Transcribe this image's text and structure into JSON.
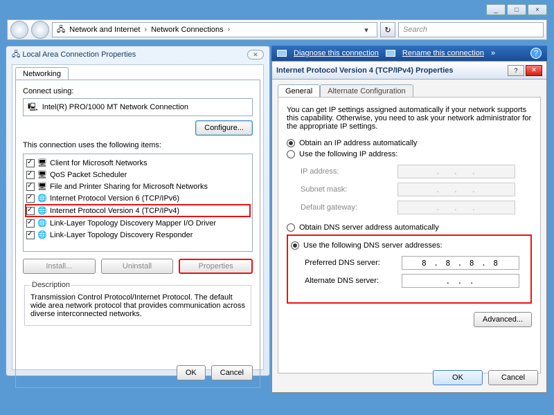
{
  "chrome": {
    "min": "_",
    "max": "□",
    "close": "×"
  },
  "nav": {
    "crumb1": "Network and Internet",
    "crumb2": "Network Connections",
    "search_placeholder": "Search"
  },
  "bluebar": {
    "diagnose": "Diagnose this connection",
    "rename": "Rename this connection",
    "more": "»"
  },
  "lan": {
    "title": "Local Area Connection Properties",
    "tab": "Networking",
    "connect_using": "Connect using:",
    "adapter": "Intel(R) PRO/1000 MT Network Connection",
    "configure": "Configure...",
    "uses_items": "This connection uses the following items:",
    "items": [
      "Client for Microsoft Networks",
      "QoS Packet Scheduler",
      "File and Printer Sharing for Microsoft Networks",
      "Internet Protocol Version 6 (TCP/IPv6)",
      "Internet Protocol Version 4 (TCP/IPv4)",
      "Link-Layer Topology Discovery Mapper I/O Driver",
      "Link-Layer Topology Discovery Responder"
    ],
    "install": "Install...",
    "uninstall": "Uninstall",
    "properties": "Properties",
    "desc_legend": "Description",
    "desc_text": "Transmission Control Protocol/Internet Protocol. The default wide area network protocol that provides communication across diverse interconnected networks.",
    "ok": "OK",
    "cancel": "Cancel"
  },
  "ipv4": {
    "title": "Internet Protocol Version 4 (TCP/IPv4) Properties",
    "tab_general": "General",
    "tab_alt": "Alternate Configuration",
    "intro": "You can get IP settings assigned automatically if your network supports this capability. Otherwise, you need to ask your network administrator for the appropriate IP settings.",
    "r_auto_ip": "Obtain an IP address automatically",
    "r_manual_ip": "Use the following IP address:",
    "lbl_ip": "IP address:",
    "lbl_mask": "Subnet mask:",
    "lbl_gw": "Default gateway:",
    "r_auto_dns": "Obtain DNS server address automatically",
    "r_manual_dns": "Use the following DNS server addresses:",
    "lbl_pdns": "Preferred DNS server:",
    "lbl_adns": "Alternate DNS server:",
    "pdns_value": "8 . 8 . 8 . 8",
    "adns_value": ".   .   .",
    "advanced": "Advanced...",
    "ok": "OK",
    "cancel": "Cancel"
  }
}
